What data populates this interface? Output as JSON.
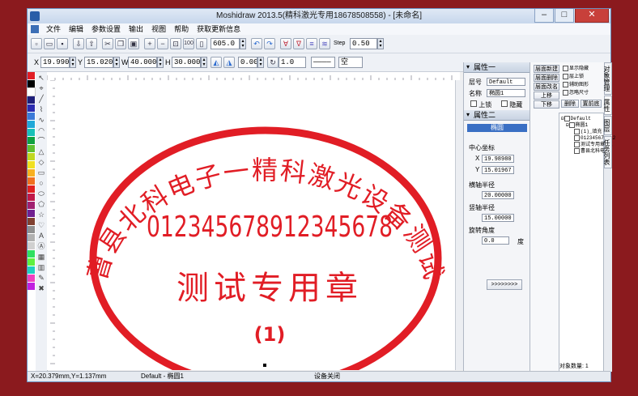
{
  "window": {
    "title": "Moshidraw 2013.5(精科激光专用18678508558) - [未命名]"
  },
  "menu": [
    "文件",
    "编辑",
    "参数设置",
    "输出",
    "视图",
    "帮助",
    "获取更新信息"
  ],
  "toolbar": {
    "zoom_value": "605.0",
    "step_label": "Step",
    "step_value": "0.50",
    "x_label": "X",
    "x_value": "19.990",
    "y_label": "Y",
    "y_value": "15.020",
    "w_label": "W",
    "w_value": "40.000",
    "h_label": "H",
    "h_value": "30.000",
    "angle_value": "0.00",
    "line_width": "1.0",
    "fill_value": "空"
  },
  "canvas": {
    "arc_text": "曹县北科电子一精科激光设备测试",
    "number_text": "012345678912345678",
    "center_text": "测试专用章",
    "bottom_text": "(1)",
    "stamp_color": "#e11d25"
  },
  "properties_panel": {
    "header1": "属性一",
    "layer_label": "层号",
    "layer_value": "Default",
    "name_label": "名称",
    "name_value": "椭圆1",
    "lock_label": "上锁",
    "hide_label": "隐藏",
    "header2": "属性二",
    "section_title": "椭圆",
    "center_label": "中心坐标",
    "cx_label": "X",
    "cx_value": "19.98980",
    "cy_label": "Y",
    "cy_value": "15.01967",
    "rx_label": "横轴半径",
    "rx_value": "20.00000",
    "ry_label": "竖轴半径",
    "ry_value": "15.00000",
    "rot_label": "旋转角度",
    "rot_value": "0.0",
    "rot_unit": "度",
    "apply_button": ">>>>>>>>"
  },
  "object_panel": {
    "buttons": [
      "层面新建",
      "显示隐藏",
      "层面删除",
      "层上锁",
      "层面改名",
      "辅助图形",
      "上移",
      "忽略尺寸",
      "下移",
      "删除",
      "置前底"
    ],
    "tree": [
      "Default",
      "椭圆1",
      "(1)_填充",
      "012345678912",
      "测试专用章_填",
      "曹县北科电子"
    ],
    "count_label": "对象数量:",
    "count_value": "1"
  },
  "side_tabs": [
    "对象管理",
    "属性",
    "图层",
    "任务列表"
  ],
  "status": {
    "coords": "X=20.379mm,Y=1.137mm",
    "selection": "Default - 椭圆1",
    "device": "设备关闭"
  },
  "palette": [
    "#e11d25",
    "#000000",
    "#ffffff",
    "#1f1f7a",
    "#2c2cb0",
    "#3c7ad8",
    "#20a8d8",
    "#18c0b8",
    "#10a040",
    "#60c030",
    "#c0d820",
    "#f0e020",
    "#f8b020",
    "#f07020",
    "#e02020",
    "#c01848",
    "#a02070",
    "#702090",
    "#804030",
    "#909090",
    "#b0b0b0",
    "#d0d0d0",
    "#30e060",
    "#60f040",
    "#20d0c0",
    "#f040c0",
    "#c020e0"
  ]
}
